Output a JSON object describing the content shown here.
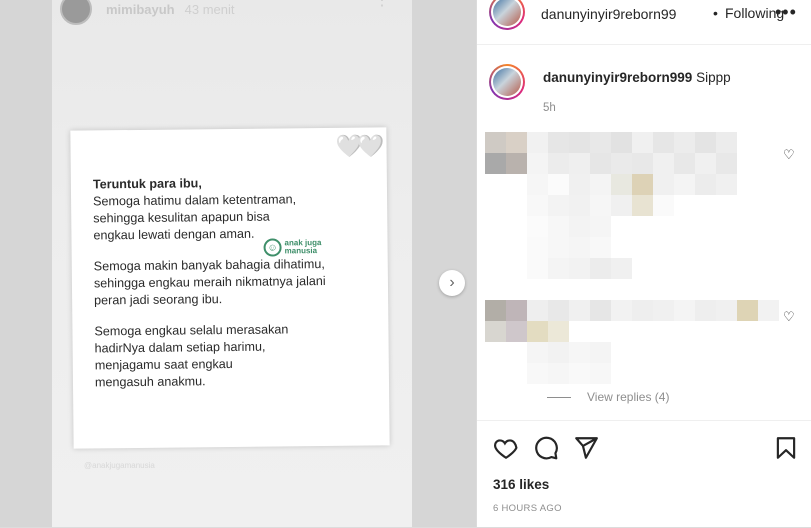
{
  "story": {
    "username": "mimibayuh",
    "time": "43 menit",
    "more": "⋮",
    "hearts": "🤍🤍",
    "poem": {
      "title": "Teruntuk para ibu,",
      "stanza1": "Semoga hatimu dalam ketentraman, sehingga kesulitan apapun bisa engkau lewati dengan aman.",
      "stanza2": "Semoga makin banyak bahagia dihatimu, sehingga engkau meraih nikmatnya jalani peran jadi seorang ibu.",
      "stanza3": "Semoga engkau selalu merasakan hadirNya dalam setiap harimu, menjagamu saat engkau mengasuh anakmu."
    },
    "logo_text": "anak juga manusia",
    "watermark": "@anakjugamanusia"
  },
  "next_icon": "chevron-right-icon",
  "header": {
    "username": "danunyinyir9reborn99",
    "separator": "•",
    "follow_status": "Following",
    "more": "•••"
  },
  "caption": {
    "username": "danunyinyir9reborn999",
    "text": "Sippp",
    "time": "5h"
  },
  "comments": {
    "view_replies": "View replies (4)"
  },
  "footer": {
    "likes": "316 likes",
    "time_ago": "6 HOURS AGO"
  },
  "colors": {
    "text": "#262626",
    "muted": "#8e8e8e",
    "border": "#dbdbdb"
  }
}
